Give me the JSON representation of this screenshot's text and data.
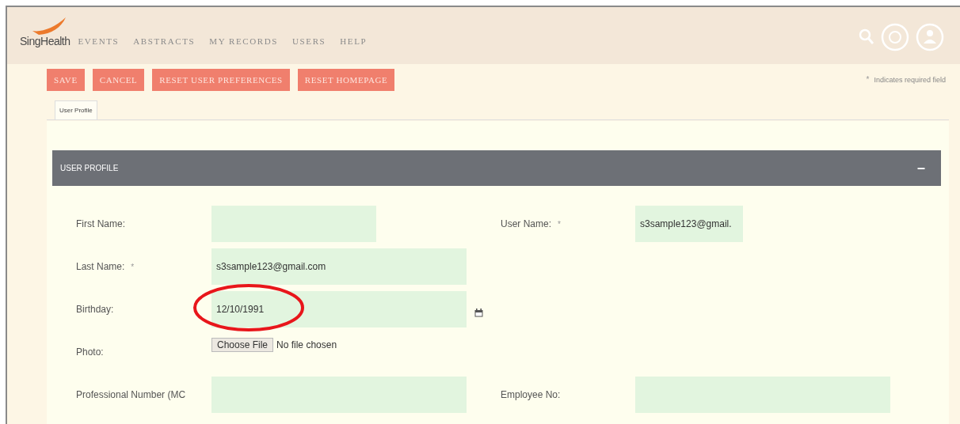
{
  "header": {
    "logo": "SingHealth",
    "nav": [
      {
        "label": "EVENTS"
      },
      {
        "label": "ABSTRACTS"
      },
      {
        "label": "MY RECORDS"
      },
      {
        "label": "USERS"
      },
      {
        "label": "HELP"
      }
    ]
  },
  "actions": [
    {
      "label": "SAVE"
    },
    {
      "label": "CANCEL"
    },
    {
      "label": "RESET USER PREFERENCES"
    },
    {
      "label": "RESET HOMEPAGE"
    }
  ],
  "required_note": {
    "mark": "*",
    "text": "Indicates required field"
  },
  "tabs": [
    {
      "label": "User Profile",
      "selected": true
    }
  ],
  "panel": {
    "title": "USER PROFILE",
    "collapse": "–",
    "expanded": true
  },
  "rows": [
    {
      "left": {
        "kind": "text",
        "label": "First Name:",
        "required": false
      },
      "right": {
        "kind": "text",
        "label": "User Name:",
        "required": true,
        "value": "s3sample123@gmail."
      }
    },
    {
      "left": {
        "kind": "text",
        "label": "Last Name:",
        "required": true,
        "value": "s3sample123@gmail.com"
      }
    },
    {
      "left": {
        "kind": "date",
        "label": "Birthday:",
        "required": false,
        "value": "12/10/1991",
        "highlighted": true
      }
    },
    {
      "left": {
        "kind": "file",
        "label": "Photo:",
        "required": false,
        "button": "Choose File",
        "status": "No file chosen"
      }
    },
    {
      "left": {
        "kind": "text",
        "label": "Professional Number (MC",
        "required": false
      },
      "right": {
        "kind": "text",
        "label": "Employee No:",
        "required": false
      }
    }
  ]
}
